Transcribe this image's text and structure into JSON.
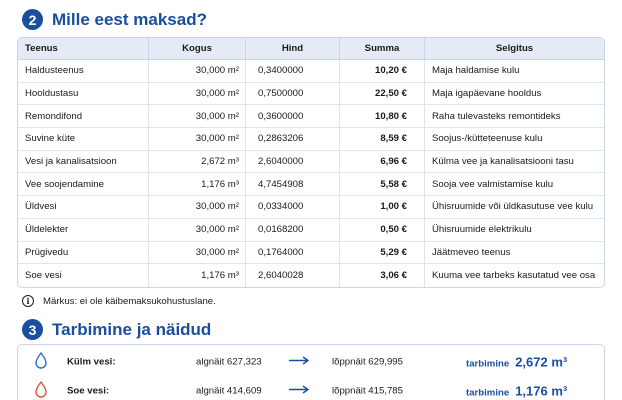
{
  "section2": {
    "number": "2",
    "title": "Mille eest maksad?"
  },
  "table": {
    "headers": [
      "Teenus",
      "Kogus",
      "Hind",
      "Summa",
      "Selgitus"
    ],
    "rows": [
      [
        "Haldusteenus",
        "30,000 m²",
        "0,3400000",
        "10,20 €",
        "Maja haldamise kulu"
      ],
      [
        "Hooldustasu",
        "30,000 m²",
        "0,7500000",
        "22,50 €",
        "Maja igapäevane hooldus"
      ],
      [
        "Remondifond",
        "30,000 m²",
        "0,3600000",
        "10,80 €",
        "Raha tulevasteks remontideks"
      ],
      [
        "Suvine küte",
        "30,000 m²",
        "0,2863206",
        "8,59 €",
        "Soojus-/kütteteenuse kulu"
      ],
      [
        "Vesi ja kanalisatsioon",
        "2,672 m³",
        "2,6040000",
        "6,96 €",
        "Külma vee ja kanalisatsiooni tasu"
      ],
      [
        "Vee soojendamine",
        "1,176 m³",
        "4,7454908",
        "5,58 €",
        "Sooja vee valmistamise kulu"
      ],
      [
        "Üldvesi",
        "30,000 m²",
        "0,0334000",
        "1,00 €",
        "Ühisruumide või üldkasutuse vee kulu"
      ],
      [
        "Üldelekter",
        "30,000 m²",
        "0,0168200",
        "0,50 €",
        "Ühisruumide elektrikulu"
      ],
      [
        "Prügivedu",
        "30,000 m²",
        "0,1764000",
        "5,29 €",
        "Jäätmeveo teenus"
      ],
      [
        "Soe vesi",
        "1,176 m³",
        "2,6040028",
        "3,06 €",
        "Kuuma vee tarbeks kasutatud vee osa"
      ]
    ]
  },
  "note": {
    "icon": "info-icon",
    "text": "Märkus: ei ole käibemaksukohustuslane."
  },
  "section3": {
    "number": "3",
    "title": "Tarbimine ja näidud"
  },
  "meters": [
    {
      "icon": "water-drop-icon",
      "color": "#2a6fd6",
      "label": "Külm vesi:",
      "start": "algnäit 627,323",
      "end": "lõppnäit 629,995",
      "use_label": "tarbimine",
      "use_value": "2,672 m³"
    },
    {
      "icon": "water-drop-icon",
      "color": "#e0503c",
      "label": "Soe vesi:",
      "start": "algnäit 414,609",
      "end": "lõppnäit 415,785",
      "use_label": "tarbimine",
      "use_value": "1,176 m³"
    }
  ],
  "colors": {
    "accent": "#1a4fa0",
    "header_bg": "#e4ebf6",
    "border": "#c9d6ea"
  }
}
